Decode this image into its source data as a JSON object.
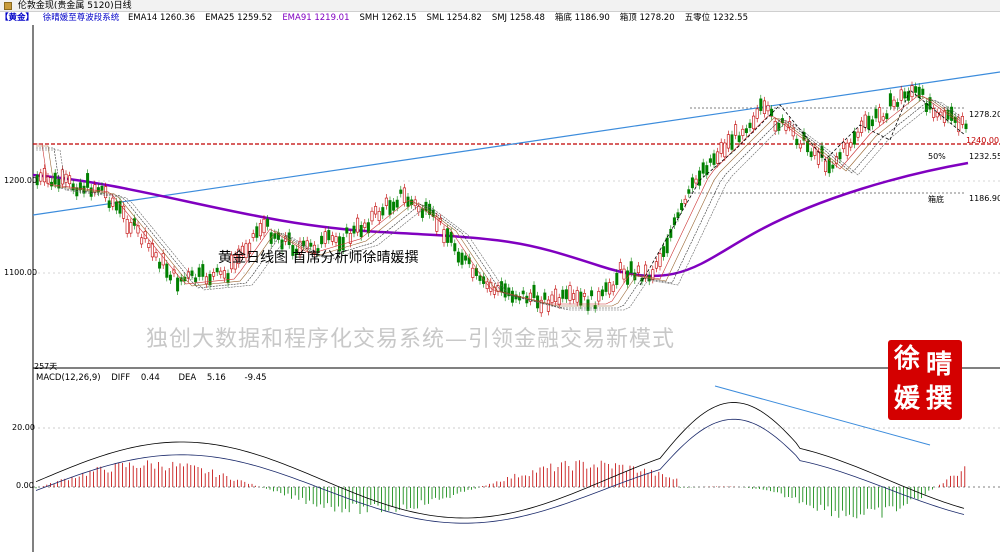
{
  "window": {
    "title": "伦敦金现(贵金属 5120)日线"
  },
  "indicators": {
    "symbol": "【黄金】",
    "system": "徐晴媛至尊波段系统",
    "items": [
      {
        "label": "EMA14",
        "value": "1260.36",
        "color": "#000000"
      },
      {
        "label": "EMA25",
        "value": "1259.52",
        "color": "#000000"
      },
      {
        "label": "EMA91",
        "value": "1219.01",
        "color": "#8000c0"
      },
      {
        "label": "SMH",
        "value": "1262.15",
        "color": "#000000"
      },
      {
        "label": "SML",
        "value": "1254.82",
        "color": "#000000"
      },
      {
        "label": "SMJ",
        "value": "1258.48",
        "color": "#000000"
      },
      {
        "label": "箱底",
        "value": "1186.90",
        "color": "#000000"
      },
      {
        "label": "箱顶",
        "value": "1278.20",
        "color": "#000000"
      },
      {
        "label": "五零位",
        "value": "1232.55",
        "color": "#000000"
      }
    ]
  },
  "main_chart": {
    "overlay_title": "黄金日线图 首席分析师徐晴媛撰",
    "slogan": "独创大数据和程序化交易系统—引领金融交易新模式",
    "axis_labels": [
      "1200.00",
      "1100.00"
    ],
    "levels": {
      "top_label": "1278.20",
      "red_label": "1240.00",
      "fifty_tag": "50%",
      "fifty_label": "1232.55",
      "bottom_tag": "箱底",
      "bottom_label": "1186.90"
    },
    "colors": {
      "up": "#c00000",
      "down": "#008000",
      "ema91": "#8000c0",
      "trend": "#3c8cdc",
      "level_red": "#c00000"
    }
  },
  "seal": {
    "chars": [
      "徐",
      "晴",
      "媛",
      "撰"
    ]
  },
  "macd": {
    "days_label": "257天",
    "title": "MACD(12,26,9)",
    "diff_label": "DIFF",
    "diff_value": "0.44",
    "dea_label": "DEA",
    "dea_value": "5.16",
    "macd_value": "-9.45",
    "axis_labels": [
      "20.00",
      "0.00"
    ]
  }
}
